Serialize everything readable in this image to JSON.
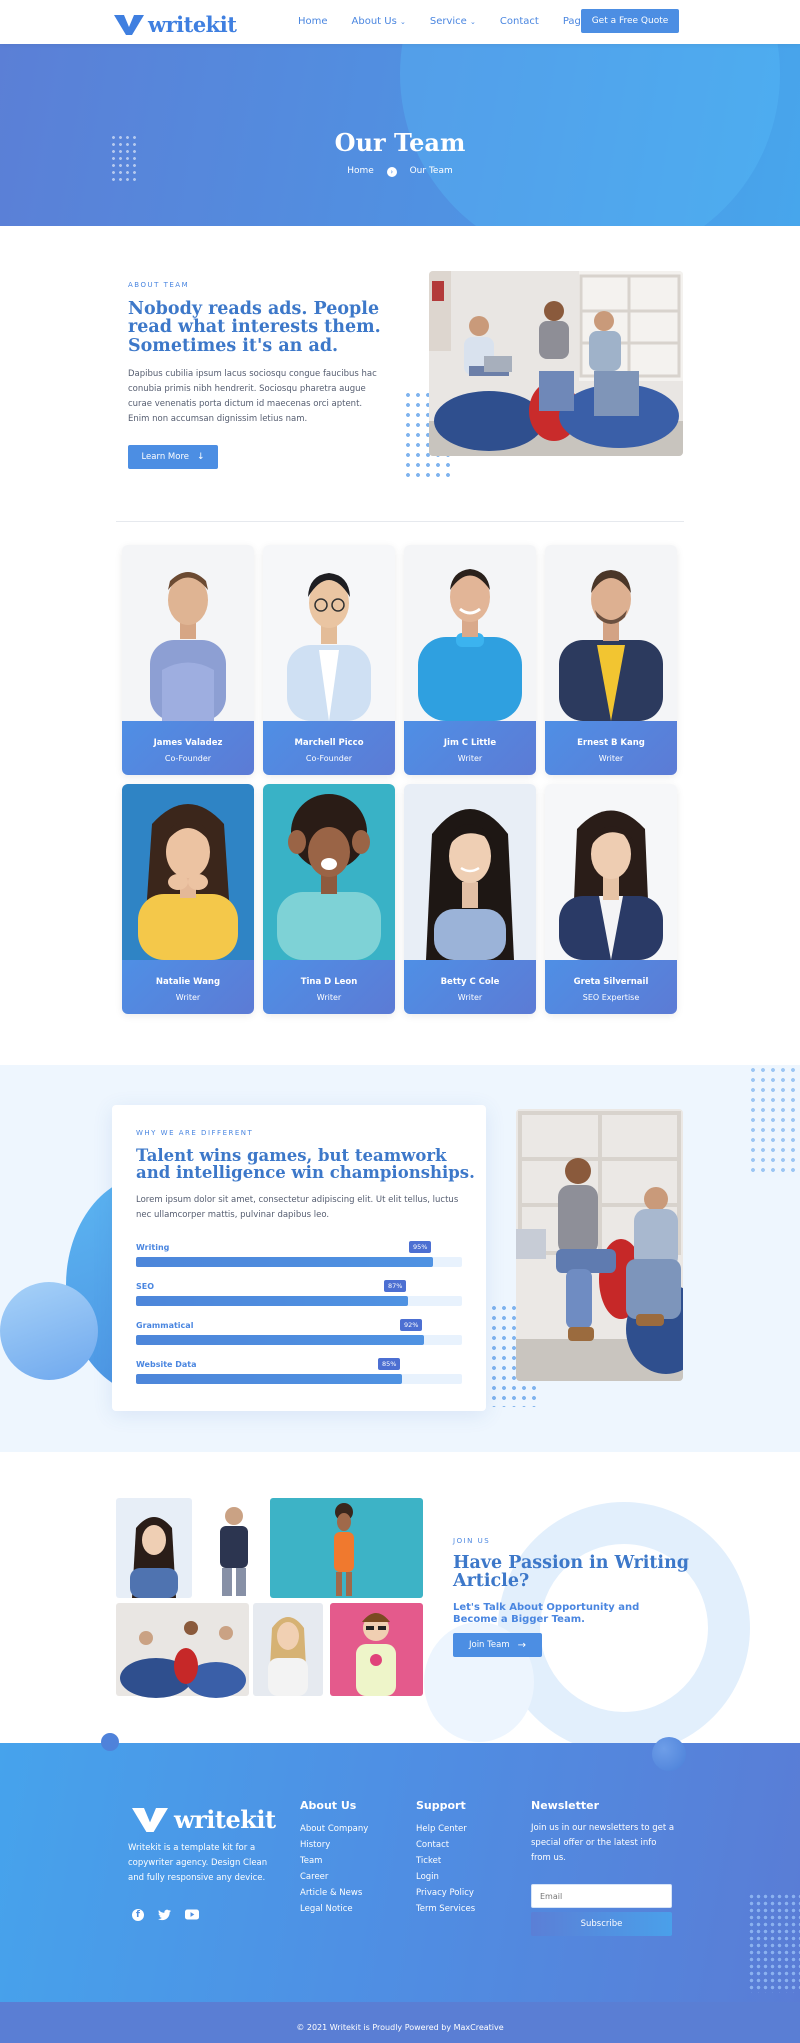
{
  "header": {
    "logo_text": "writekit",
    "nav": [
      {
        "label": "Home",
        "dropdown": false
      },
      {
        "label": "About Us",
        "dropdown": true
      },
      {
        "label": "Service",
        "dropdown": true
      },
      {
        "label": "Contact",
        "dropdown": false
      },
      {
        "label": "Page",
        "dropdown": true
      }
    ],
    "cta": "Get a Free Quote"
  },
  "hero": {
    "title": "Our Team",
    "crumb_home": "Home",
    "crumb_current": "Our Team"
  },
  "about": {
    "eyebrow": "ABOUT TEAM",
    "heading_lines": [
      "Nobody reads ads. People",
      "read what interests them.",
      "Sometimes it's an ad."
    ],
    "paragraph": "Dapibus cubilia ipsum lacus sociosqu congue faucibus hac conubia primis nibh hendrerit. Sociosqu pharetra augue curae venenatis porta dictum id maecenas orci aptent. Enim non accumsan dignissim letius nam.",
    "button": "Learn More"
  },
  "team": [
    {
      "name": "James Valadez",
      "role": "Co-Founder"
    },
    {
      "name": "Marchell Picco",
      "role": "Co-Founder"
    },
    {
      "name": "Jim C Little",
      "role": "Writer"
    },
    {
      "name": "Ernest B Kang",
      "role": "Writer"
    },
    {
      "name": "Natalie Wang",
      "role": "Writer"
    },
    {
      "name": "Tina D Leon",
      "role": "Writer"
    },
    {
      "name": "Betty C Cole",
      "role": "Writer"
    },
    {
      "name": "Greta Silvernail",
      "role": "SEO Expertise"
    }
  ],
  "skills": {
    "eyebrow": "WHY WE ARE DIFFERENT",
    "heading_lines": [
      "Talent wins games, but teamwork",
      "and intelligence win championships."
    ],
    "paragraph": "Lorem ipsum dolor sit amet, consectetur adipiscing elit. Ut elit tellus, luctus nec ullamcorper mattis, pulvinar dapibus leo.",
    "bars": [
      {
        "label": "Writing",
        "percent": 95,
        "percent_text": "95%"
      },
      {
        "label": "SEO",
        "percent": 87,
        "percent_text": "87%"
      },
      {
        "label": "Grammatical",
        "percent": 92,
        "percent_text": "92%"
      },
      {
        "label": "Website Data",
        "percent": 85,
        "percent_text": "85%"
      }
    ]
  },
  "join": {
    "eyebrow": "JOIN US",
    "heading_lines": [
      "Have Passion in Writing",
      "Article?"
    ],
    "subheading_lines": [
      "Let's Talk About Opportunity and",
      "Become a Bigger Team."
    ],
    "button": "Join Team"
  },
  "footer": {
    "logo_text": "writekit",
    "description": "Writekit is a template kit for a copywriter agency. Design Clean and fully responsive any device.",
    "about_title": "About Us",
    "about_links": [
      "About Company",
      "History",
      "Team",
      "Career",
      "Article & News",
      "Legal Notice"
    ],
    "support_title": "Support",
    "support_links": [
      "Help Center",
      "Contact",
      "Ticket",
      "Login",
      "Privacy Policy",
      "Term Services"
    ],
    "newsletter_title": "Newsletter",
    "newsletter_text": "Join us in our newsletters to get a special offer or the latest info from us.",
    "email_placeholder": "Email",
    "subscribe": "Subscribe",
    "copyright": "© 2021 Writekit is Proudly Powered by MaxCreative"
  },
  "colors": {
    "primary": "#4c8ee3",
    "heading": "#3d78c9",
    "accent_dark": "#4c6fd2",
    "light_bg": "#eef6fe"
  },
  "icons": [
    "chevron-down-icon",
    "arrow-right-circle-icon",
    "arrow-down-icon",
    "arrow-right-icon",
    "facebook-icon",
    "twitter-icon",
    "youtube-icon"
  ]
}
